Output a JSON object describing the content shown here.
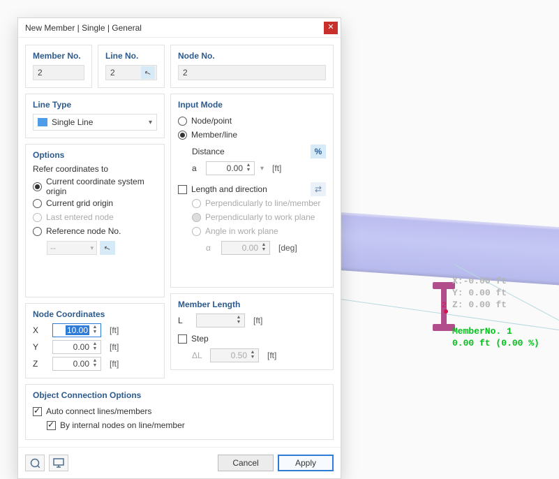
{
  "viewport": {
    "coords": {
      "x_label": "X:",
      "x_val": "-0.00",
      "y_label": "Y:",
      "y_val": " 0.00",
      "z_label": "Z:",
      "z_val": " 0.00",
      "unit": "ft"
    },
    "node_label": "2",
    "member_line1": "MemberNo. 1",
    "member_line2": "0.00 ft (0.00 %)"
  },
  "dialog": {
    "title": "New Member | Single | General",
    "close_label": "✕",
    "member_no": {
      "label": "Member No.",
      "value": "2"
    },
    "line_no": {
      "label": "Line No.",
      "value": "2"
    },
    "node_no": {
      "label": "Node No.",
      "value": "2"
    },
    "line_type": {
      "label": "Line Type",
      "value": "Single Line"
    },
    "options": {
      "label": "Options",
      "refer_label": "Refer coordinates to",
      "items": [
        {
          "label": "Current coordinate system origin",
          "selected": true,
          "disabled": false
        },
        {
          "label": "Current grid origin",
          "selected": false,
          "disabled": false
        },
        {
          "label": "Last entered node",
          "selected": false,
          "disabled": true
        },
        {
          "label": "Reference node No.",
          "selected": false,
          "disabled": false
        }
      ],
      "ref_node_value": "--"
    },
    "input_mode": {
      "label": "Input Mode",
      "items": [
        {
          "label": "Node/point",
          "selected": false
        },
        {
          "label": "Member/line",
          "selected": true
        }
      ],
      "distance_label": "Distance",
      "percent_label": "%",
      "a_label": "a",
      "a_value": "0.00",
      "a_unit": "[ft]",
      "len_dir": {
        "checked": false,
        "label": "Length and direction",
        "swap_label": "⇄",
        "subitems": [
          "Perpendicularly to line/member",
          "Perpendicularly to work plane",
          "Angle in work plane"
        ],
        "alpha_label": "α",
        "alpha_value": "0.00",
        "alpha_unit": "[deg]"
      }
    },
    "node_coords": {
      "label": "Node Coordinates",
      "rows": [
        {
          "lbl": "X",
          "val": "10.00",
          "unit": "[ft]",
          "focused": true
        },
        {
          "lbl": "Y",
          "val": "0.00",
          "unit": "[ft]",
          "focused": false
        },
        {
          "lbl": "Z",
          "val": "0.00",
          "unit": "[ft]",
          "focused": false
        }
      ]
    },
    "member_length": {
      "label": "Member Length",
      "l_label": "L",
      "l_value": "",
      "l_unit": "[ft]",
      "step_label": "Step",
      "step_checked": false,
      "dl_label": "ΔL",
      "dl_value": "0.50",
      "dl_unit": "[ft]"
    },
    "obj_conn": {
      "label": "Object Connection Options",
      "items": [
        {
          "label": "Auto connect lines/members",
          "checked": true
        },
        {
          "label": "By internal nodes on line/member",
          "checked": true
        }
      ]
    },
    "footer": {
      "help_icon": "?",
      "monitor_icon": "▭",
      "cancel": "Cancel",
      "apply": "Apply"
    }
  }
}
